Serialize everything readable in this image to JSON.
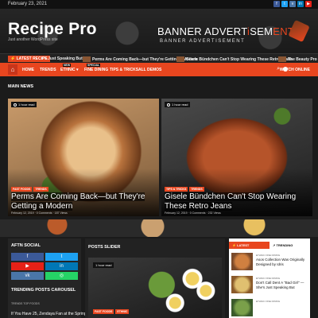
{
  "topbar": {
    "date": "February 23, 2021",
    "social": [
      {
        "icon": "facebook-icon",
        "glyph": "f",
        "color": "#3b5998"
      },
      {
        "icon": "twitter-icon",
        "glyph": "t",
        "color": "#1da1f2"
      },
      {
        "icon": "vk-icon",
        "glyph": "v",
        "color": "#4a76a8"
      },
      {
        "icon": "linkedin-icon",
        "glyph": "in",
        "color": "#0077b5"
      },
      {
        "icon": "youtube-icon",
        "glyph": "▶",
        "color": "#e62117"
      }
    ]
  },
  "header": {
    "logo": "Recipe Pro",
    "tagline": "Just another WordPress site",
    "banner_line1_a": "BANNER ADVERT",
    "banner_line1_b": "i",
    "banner_line1_c": "SEM",
    "banner_line1_d": "ENT",
    "banner_line2": "BANNER ADVERTISEMENT"
  },
  "ticker": {
    "label": "⚡ LATEST RECIPE",
    "items": [
      "e's Just Speaking But",
      "Perms Are Coming Back—but They're Getting a Modern",
      "Gisele Bündchen Can't Stop Wearing These Retro Jeans",
      "The Beauty Pro"
    ]
  },
  "nav": {
    "home": "⌂",
    "items": [
      "HOME",
      "TRENDS",
      "ETHNIC ▾",
      "FINE DINING",
      "TIPS & TRICKS",
      "ALL DEMOS"
    ],
    "badges": {
      "trends": "",
      "ethnic": "NEW",
      "fine_dining": "SPECIAL"
    },
    "search": "⌕",
    "watch": "WATCH ONLINE"
  },
  "main": {
    "section_title": "MAIN NEWS",
    "cards": [
      {
        "time": "1 hour read",
        "tags": [
          "FAST FOODS",
          "TRENDS"
        ],
        "title": "Perms Are Coming Back—but They're Getting a Modern",
        "meta": "February 12, 2019  ·  0 Comments  ·  187 Views"
      },
      {
        "time": "1 hour read",
        "tags": [
          "TIPS & TRICKS",
          "TRENDS"
        ],
        "title": "Gisele Bündchen Can't Stop Wearing These Retro Jeans",
        "meta": "February 12, 2019  ·  0 Comments  ·  232 Views"
      }
    ]
  },
  "social_panel": {
    "title": "AFTN SOCIAL",
    "buttons": [
      {
        "glyph": "f",
        "color": "#3b5998"
      },
      {
        "glyph": "t",
        "color": "#1da1f2"
      },
      {
        "glyph": "▶",
        "color": "#e62117"
      },
      {
        "glyph": "in",
        "color": "#0077b5"
      },
      {
        "glyph": "vk",
        "color": "#4a76a8"
      },
      {
        "glyph": "◎",
        "color": "#25d366"
      }
    ],
    "carousel_title": "TRENDING POSTS CAROUSEL",
    "carousel_cat": "TRENDS   TOP FOODS",
    "carousel_post": "If You Have 25, Zendaya Fan at the Spring"
  },
  "slider": {
    "title": "POSTS SLIDER",
    "time": "1 hour read",
    "tags": [
      "FAST FOODS",
      "ETHNIC"
    ]
  },
  "sidebar": {
    "tabs": [
      "⚡ LATEST",
      "↗ TRENDING"
    ],
    "items": [
      {
        "cat": "ETHNIC   FINE DINING",
        "title": "Asos Collection Was Originally Designed by Idris"
      },
      {
        "cat": "ETHNIC   FINE DINING",
        "title": "Don't Call Dent A \"Bad Girl\" — She's Just Speaking But"
      },
      {
        "cat": "ETHNIC   FINE DINING",
        "title": ""
      }
    ]
  },
  "colors": {
    "accent": "#e8461f",
    "background": "#1b1b1b"
  }
}
